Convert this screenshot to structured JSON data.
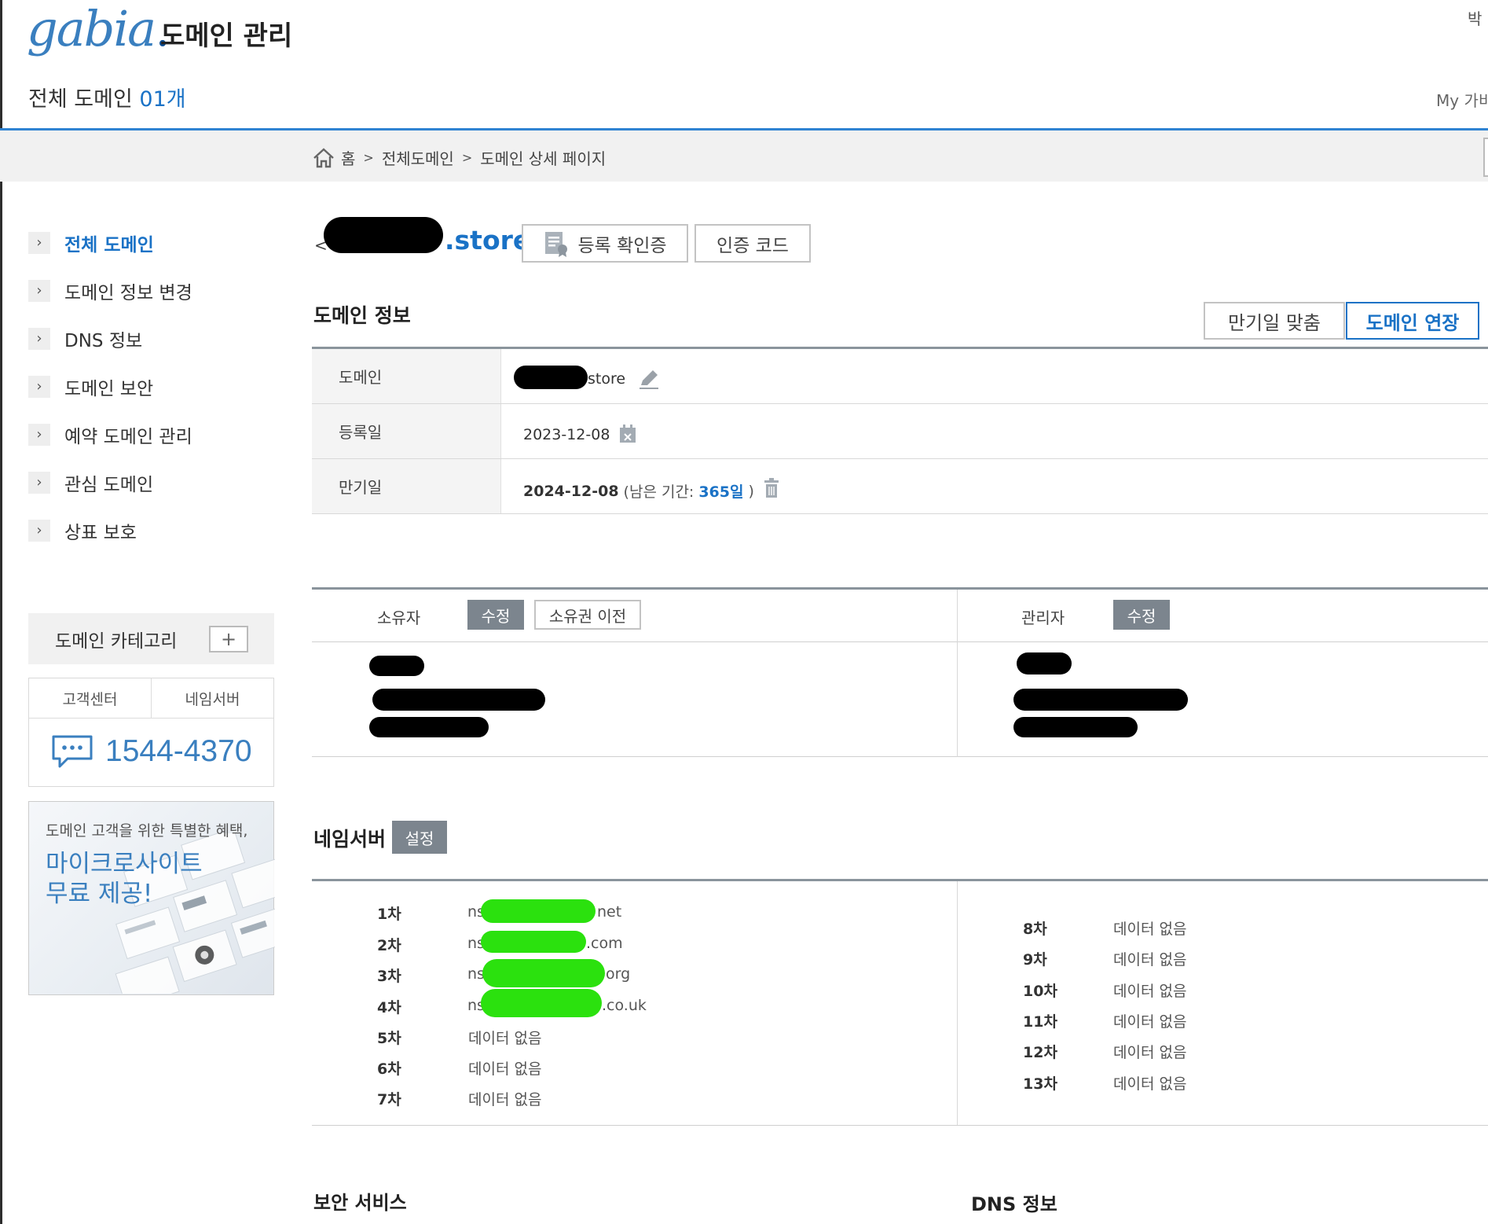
{
  "header": {
    "logo_text": "gabia",
    "logo_dot": ".",
    "title": "도메인 관리",
    "user_name": "박",
    "all_domains_label": "전체 도메인",
    "all_domains_count": "01개",
    "my_link": "My 가비"
  },
  "breadcrumb": {
    "items": [
      "홈",
      "전체도메인",
      "도메인 상세 페이지"
    ],
    "separator": ">"
  },
  "sidebar": {
    "items": [
      {
        "label": "전체 도메인",
        "active": true
      },
      {
        "label": "도메인 정보 변경"
      },
      {
        "label": "DNS 정보"
      },
      {
        "label": "도메인 보안"
      },
      {
        "label": "예약 도메인 관리"
      },
      {
        "label": "관심 도메인"
      },
      {
        "label": "상표 보호"
      }
    ],
    "category_label": "도메인 카테고리",
    "category_add": "+",
    "cs_tabs": [
      "고객센터",
      "네임서버"
    ],
    "cs_phone": "1544-4370",
    "banner_sub": "도메인 고객을 위한 특별한 혜택,",
    "banner_title_1": "마이크로사이트",
    "banner_title_2": "무료 제공!"
  },
  "domain_head": {
    "back": "<",
    "suffix": ".store",
    "reg_cert_button": "등록 확인증",
    "auth_code_button": "인증 코드"
  },
  "domain_info": {
    "title": "도메인 정보",
    "expire_match_button": "만기일 맞춤",
    "renew_button": "도메인 연장",
    "rows": {
      "domain_label": "도메인",
      "domain_value": "store",
      "reg_label": "등록일",
      "reg_value": "2023-12-08",
      "exp_label": "만기일",
      "exp_value": "2024-12-08",
      "remaining_prefix": "(남은 기간:",
      "remaining_days": "365일",
      "remaining_suffix": ")"
    }
  },
  "contacts": {
    "owner_label": "소유자",
    "owner_edit": "수정",
    "owner_transfer": "소유권 이전",
    "admin_label": "관리자",
    "admin_edit": "수정"
  },
  "nameservers": {
    "title": "네임서버",
    "settings_button": "설정",
    "left": [
      {
        "rank": "1차",
        "prefix": "ns",
        "suffix": "net"
      },
      {
        "rank": "2차",
        "prefix": "ns",
        "suffix": ".com"
      },
      {
        "rank": "3차",
        "prefix": "ns",
        "suffix": "org"
      },
      {
        "rank": "4차",
        "prefix": "ns",
        "suffix": ".co.uk"
      },
      {
        "rank": "5차",
        "value": "데이터 없음"
      },
      {
        "rank": "6차",
        "value": "데이터 없음"
      },
      {
        "rank": "7차",
        "value": "데이터 없음"
      }
    ],
    "right": [
      {
        "rank": "8차",
        "value": "데이터 없음"
      },
      {
        "rank": "9차",
        "value": "데이터 없음"
      },
      {
        "rank": "10차",
        "value": "데이터 없음"
      },
      {
        "rank": "11차",
        "value": "데이터 없음"
      },
      {
        "rank": "12차",
        "value": "데이터 없음"
      },
      {
        "rank": "13차",
        "value": "데이터 없음"
      }
    ]
  },
  "footer_sections": {
    "security_title": "보안 서비스",
    "dns_title": "DNS 정보"
  },
  "colors": {
    "accent_blue": "#1a72c6",
    "header_line": "#2f83d2",
    "gray_button": "#7c858e"
  }
}
